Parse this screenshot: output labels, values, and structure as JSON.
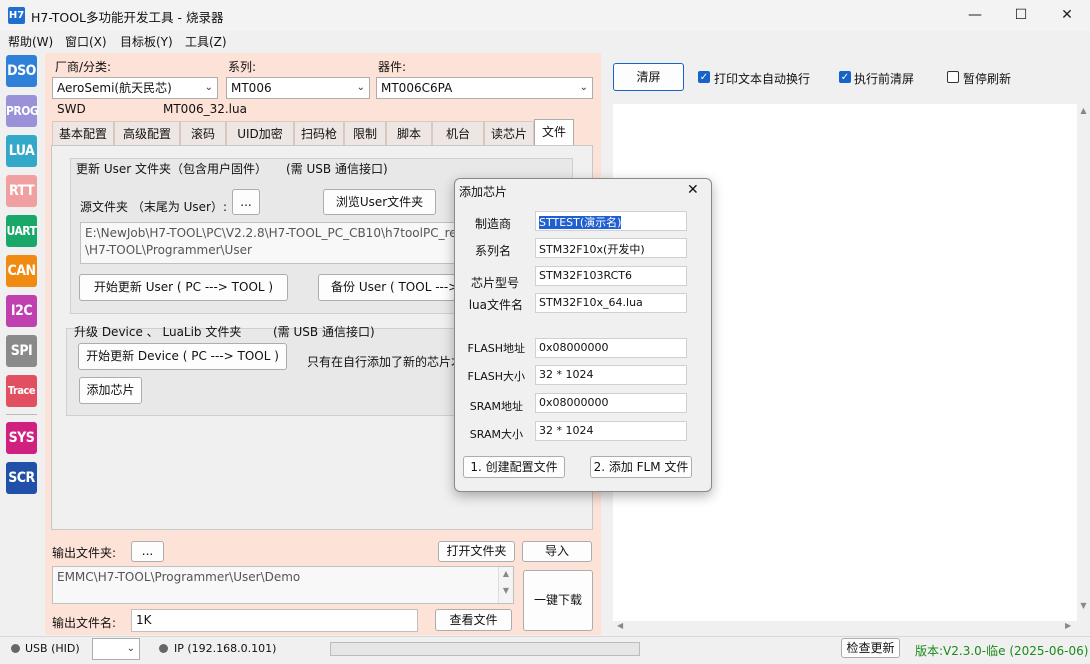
{
  "window": {
    "logo": "H7",
    "title": "H7-TOOL多功能开发工具 - 烧录器",
    "minimize": "—",
    "maximize": "☐",
    "close": "✕"
  },
  "menu": [
    "帮助(W)",
    "窗口(X)",
    "目标板(Y)",
    "工具(Z)"
  ],
  "sidebar": [
    {
      "label": "DSO",
      "color": "#2f80d8"
    },
    {
      "label": "PROG",
      "color": "#9a92d8"
    },
    {
      "label": "LUA",
      "color": "#33a8c8"
    },
    {
      "label": "RTT",
      "color": "#f0a0a0"
    },
    {
      "label": "UART",
      "color": "#1aa86a"
    },
    {
      "label": "CAN",
      "color": "#f08a10"
    },
    {
      "label": "I2C",
      "color": "#c040b0"
    },
    {
      "label": "SPI",
      "color": "#8a8a8a"
    },
    {
      "label": "Trace",
      "color": "#e05060"
    },
    {
      "label": "SYS",
      "color": "#d02080"
    },
    {
      "label": "SCR",
      "color": "#2050a8"
    }
  ],
  "selectors": {
    "vendor_label": "厂商/分类:",
    "vendor_value": "AeroSemi(航天民芯)",
    "series_label": "系列:",
    "series_value": "MT006",
    "device_label": "器件:",
    "device_value": "MT006C6PA",
    "interface": "SWD",
    "lua_file": "MT006_32.lua"
  },
  "tabs": [
    "基本配置",
    "高级配置",
    "滚码",
    "UID加密",
    "扫码枪",
    "限制",
    "脚本",
    "机台",
    "读芯片",
    "文件"
  ],
  "user_group": {
    "title": "更新 User 文件夹（包含用户固件）",
    "title_note": "(需 USB 通信接口)",
    "source_label": "源文件夹 （末尾为 User）:",
    "dots_button": "...",
    "browse_button": "浏览User文件夹",
    "path_line1": "E:\\NewJob\\H7-TOOL\\PC\\V2.2.8\\H7-TOOL_PC_CB10\\h7toolPC_re",
    "path_line2": "\\H7-TOOL\\Programmer\\User",
    "start_update_button": "开始更新 User ( PC ---> TOOL )",
    "backup_button": "备份 User ( TOOL --->"
  },
  "device_group": {
    "title": "升级 Device 、 LuaLib 文件夹",
    "title_note": "(需 USB 通信接口)",
    "start_update_button": "开始更新 Device ( PC ---> TOOL )",
    "note": "只有在自行添加了新的芯片才",
    "add_chip_button": "添加芯片"
  },
  "output": {
    "folder_label": "输出文件夹:",
    "dots_button": "...",
    "open_folder_button": "打开文件夹",
    "import_button": "导入",
    "folder_path": "EMMC\\H7-TOOL\\Programmer\\User\\Demo",
    "filename_label": "输出文件名:",
    "filename_value": "1K",
    "view_file_button": "查看文件",
    "download_button": "一键下载"
  },
  "right": {
    "clear_button": "清屏",
    "wrap_label": "打印文本自动换行",
    "clear_before_label": "执行前清屏",
    "pause_label": "暂停刷新",
    "wrap_checked": true,
    "clear_before_checked": true,
    "pause_checked": false
  },
  "status": {
    "usb_label": "USB (HID)",
    "ip_label": "IP (192.168.0.101)",
    "check_update_button": "检查更新",
    "version": "版本:V2.3.0-临e (2025-06-06)"
  },
  "dialog": {
    "title": "添加芯片",
    "close": "✕",
    "fields": [
      {
        "label": "制造商",
        "value": "STTEST(演示名)"
      },
      {
        "label": "系列名",
        "value": "STM32F10x(开发中)"
      },
      {
        "label": "芯片型号",
        "value": "STM32F103RCT6"
      },
      {
        "label": "lua文件名",
        "value": "STM32F10x_64.lua"
      },
      {
        "label": "FLASH地址",
        "value": "0x08000000"
      },
      {
        "label": "FLASH大小",
        "value": "32 * 1024"
      },
      {
        "label": "SRAM地址",
        "value": "0x08000000"
      },
      {
        "label": "SRAM大小",
        "value": "32 * 1024"
      }
    ],
    "create_config_button": "1. 创建配置文件",
    "add_flm_button": "2. 添加 FLM 文件"
  }
}
